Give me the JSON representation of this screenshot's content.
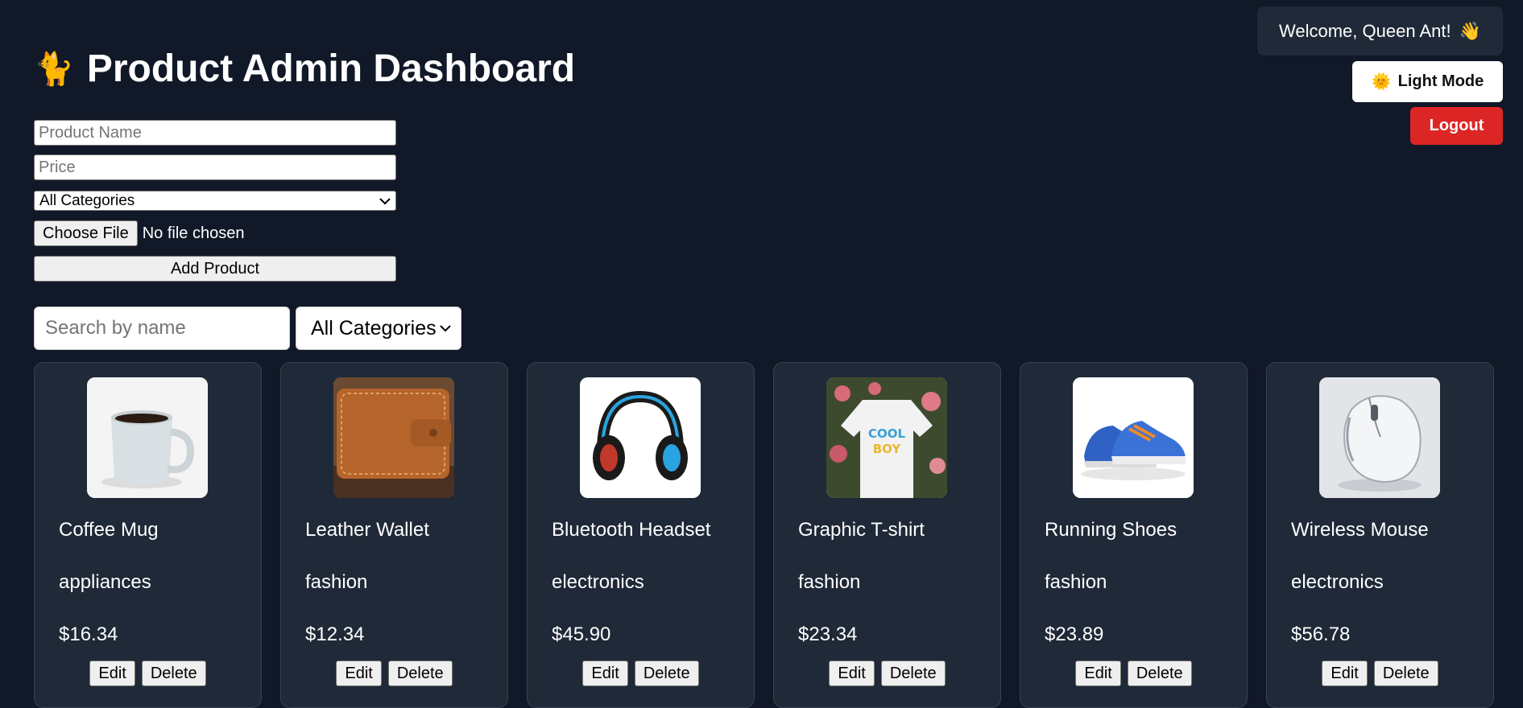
{
  "header": {
    "welcome_text": "Welcome, Queen Ant!",
    "welcome_emoji": "👋",
    "mode_emoji": "🌞",
    "mode_label": "Light Mode",
    "logout_label": "Logout",
    "title_emoji": "🐈",
    "title": "Product Admin Dashboard"
  },
  "form": {
    "name_placeholder": "Product Name",
    "price_placeholder": "Price",
    "category_selected": "All Categories",
    "file_button": "Choose File",
    "file_status": "No file chosen",
    "add_button": "Add Product"
  },
  "filters": {
    "search_placeholder": "Search by name",
    "category_selected": "All Categories"
  },
  "products": [
    {
      "name": "Coffee Mug",
      "category": "appliances",
      "price": "$16.34",
      "edit": "Edit",
      "delete": "Delete"
    },
    {
      "name": "Leather Wallet",
      "category": "fashion",
      "price": "$12.34",
      "edit": "Edit",
      "delete": "Delete"
    },
    {
      "name": "Bluetooth Headset",
      "category": "electronics",
      "price": "$45.90",
      "edit": "Edit",
      "delete": "Delete"
    },
    {
      "name": "Graphic T-shirt",
      "category": "fashion",
      "price": "$23.34",
      "edit": "Edit",
      "delete": "Delete"
    },
    {
      "name": "Running Shoes",
      "category": "fashion",
      "price": "$23.89",
      "edit": "Edit",
      "delete": "Delete"
    },
    {
      "name": "Wireless Mouse",
      "category": "electronics",
      "price": "$56.78",
      "edit": "Edit",
      "delete": "Delete"
    }
  ],
  "colors": {
    "background": "#111827",
    "card": "#1f2937",
    "logout": "#dc2626"
  }
}
